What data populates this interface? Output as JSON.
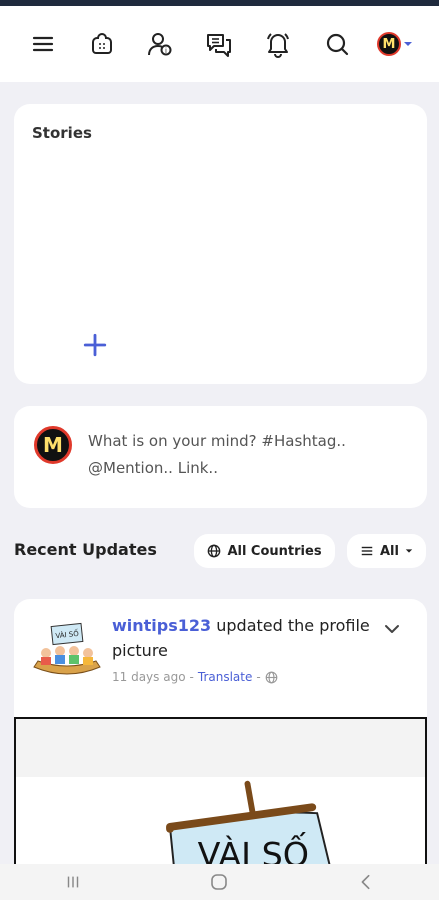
{
  "nav": {
    "icons": [
      "menu-icon",
      "stories-icon",
      "friend-requests-icon",
      "messages-icon",
      "notifications-icon",
      "search-icon",
      "profile-avatar",
      "caret-down-icon"
    ],
    "avatar_letter": "M"
  },
  "stories": {
    "title": "Stories",
    "add_symbol": "+"
  },
  "composer": {
    "avatar_letter": "M",
    "placeholder": "What is on your mind? #Hashtag.. @Mention.. Link.."
  },
  "recent": {
    "title": "Recent Updates",
    "countries_filter": "All Countries",
    "type_filter": "All"
  },
  "post": {
    "username": "wintips123",
    "action": " updated the profile picture",
    "time": "11 days ago",
    "separator": "-",
    "translate": "Translate",
    "avatar_sign_text": "VÀI SỐ",
    "image_sign_text": "VÀI SỐ"
  },
  "colors": {
    "accent": "#4a5fd6",
    "background": "#f0f0f5",
    "card": "#ffffff",
    "status_bar": "#1f2a3d"
  }
}
